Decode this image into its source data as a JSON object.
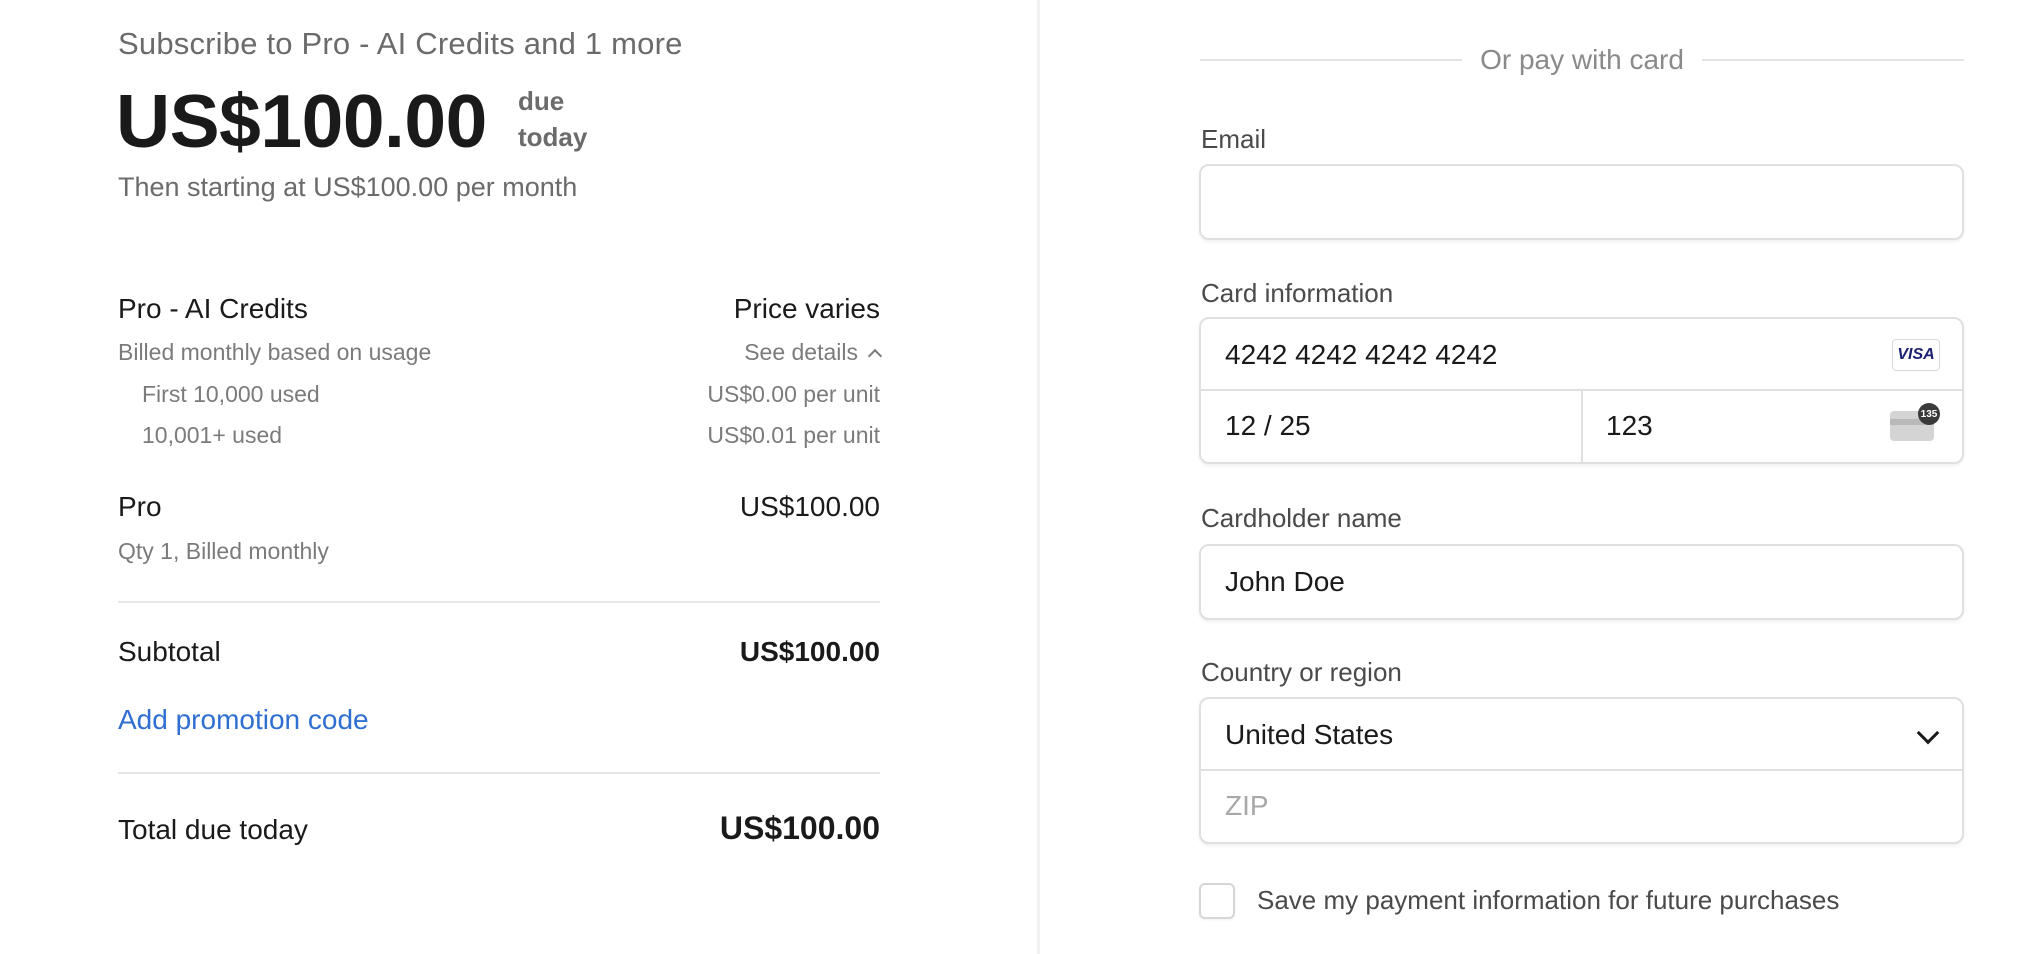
{
  "summary": {
    "subscribe_title": "Subscribe to Pro - AI Credits and 1 more",
    "amount": "US$100.00",
    "due_line1": "due",
    "due_line2": "today",
    "then_starting": "Then starting at US$100.00 per month"
  },
  "items": {
    "credits": {
      "name": "Pro - AI Credits",
      "price": "Price varies",
      "billing": "Billed monthly based on usage",
      "see_details": "See details",
      "tiers": [
        {
          "label": "First 10,000 used",
          "value": "US$0.00 per unit"
        },
        {
          "label": "10,001+ used",
          "value": "US$0.01 per unit"
        }
      ]
    },
    "pro": {
      "name": "Pro",
      "price": "US$100.00",
      "qty": "Qty 1, Billed monthly"
    }
  },
  "totals": {
    "subtotal_label": "Subtotal",
    "subtotal_value": "US$100.00",
    "promo_link": "Add promotion code",
    "total_label": "Total due today",
    "total_value": "US$100.00"
  },
  "form": {
    "or_pay": "Or pay with card",
    "email_label": "Email",
    "email_value": "",
    "card_label": "Card information",
    "card_number": "4242 4242 4242 4242",
    "card_brand": "VISA",
    "expiry": "12 / 25",
    "cvc": "123",
    "cvc_badge": "135",
    "name_label": "Cardholder name",
    "name_value": "John Doe",
    "country_label": "Country or region",
    "country_value": "United States",
    "zip_placeholder": "ZIP",
    "save_label": "Save my payment information for future purchases"
  },
  "colors": {
    "link": "#2f6fd1",
    "muted": "#6b6b6b",
    "border": "#e0e0e0"
  },
  "icons": [
    "chevron-up-icon",
    "visa-card-icon",
    "cvc-card-icon",
    "chevron-down-icon"
  ]
}
